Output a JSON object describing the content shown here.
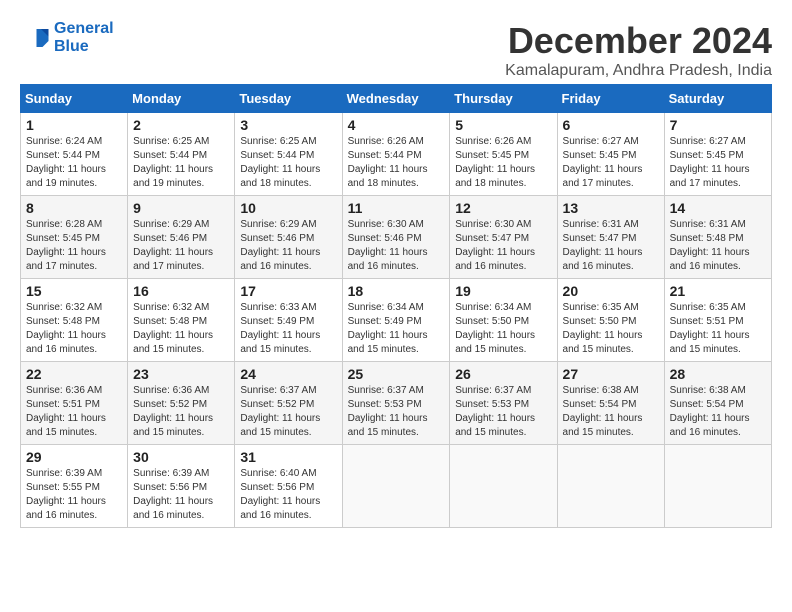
{
  "header": {
    "logo_line1": "General",
    "logo_line2": "Blue",
    "main_title": "December 2024",
    "subtitle": "Kamalapuram, Andhra Pradesh, India"
  },
  "weekdays": [
    "Sunday",
    "Monday",
    "Tuesday",
    "Wednesday",
    "Thursday",
    "Friday",
    "Saturday"
  ],
  "weeks": [
    [
      {
        "day": "1",
        "info": "Sunrise: 6:24 AM\nSunset: 5:44 PM\nDaylight: 11 hours\nand 19 minutes."
      },
      {
        "day": "2",
        "info": "Sunrise: 6:25 AM\nSunset: 5:44 PM\nDaylight: 11 hours\nand 19 minutes."
      },
      {
        "day": "3",
        "info": "Sunrise: 6:25 AM\nSunset: 5:44 PM\nDaylight: 11 hours\nand 18 minutes."
      },
      {
        "day": "4",
        "info": "Sunrise: 6:26 AM\nSunset: 5:44 PM\nDaylight: 11 hours\nand 18 minutes."
      },
      {
        "day": "5",
        "info": "Sunrise: 6:26 AM\nSunset: 5:45 PM\nDaylight: 11 hours\nand 18 minutes."
      },
      {
        "day": "6",
        "info": "Sunrise: 6:27 AM\nSunset: 5:45 PM\nDaylight: 11 hours\nand 17 minutes."
      },
      {
        "day": "7",
        "info": "Sunrise: 6:27 AM\nSunset: 5:45 PM\nDaylight: 11 hours\nand 17 minutes."
      }
    ],
    [
      {
        "day": "8",
        "info": "Sunrise: 6:28 AM\nSunset: 5:45 PM\nDaylight: 11 hours\nand 17 minutes."
      },
      {
        "day": "9",
        "info": "Sunrise: 6:29 AM\nSunset: 5:46 PM\nDaylight: 11 hours\nand 17 minutes."
      },
      {
        "day": "10",
        "info": "Sunrise: 6:29 AM\nSunset: 5:46 PM\nDaylight: 11 hours\nand 16 minutes."
      },
      {
        "day": "11",
        "info": "Sunrise: 6:30 AM\nSunset: 5:46 PM\nDaylight: 11 hours\nand 16 minutes."
      },
      {
        "day": "12",
        "info": "Sunrise: 6:30 AM\nSunset: 5:47 PM\nDaylight: 11 hours\nand 16 minutes."
      },
      {
        "day": "13",
        "info": "Sunrise: 6:31 AM\nSunset: 5:47 PM\nDaylight: 11 hours\nand 16 minutes."
      },
      {
        "day": "14",
        "info": "Sunrise: 6:31 AM\nSunset: 5:48 PM\nDaylight: 11 hours\nand 16 minutes."
      }
    ],
    [
      {
        "day": "15",
        "info": "Sunrise: 6:32 AM\nSunset: 5:48 PM\nDaylight: 11 hours\nand 16 minutes."
      },
      {
        "day": "16",
        "info": "Sunrise: 6:32 AM\nSunset: 5:48 PM\nDaylight: 11 hours\nand 15 minutes."
      },
      {
        "day": "17",
        "info": "Sunrise: 6:33 AM\nSunset: 5:49 PM\nDaylight: 11 hours\nand 15 minutes."
      },
      {
        "day": "18",
        "info": "Sunrise: 6:34 AM\nSunset: 5:49 PM\nDaylight: 11 hours\nand 15 minutes."
      },
      {
        "day": "19",
        "info": "Sunrise: 6:34 AM\nSunset: 5:50 PM\nDaylight: 11 hours\nand 15 minutes."
      },
      {
        "day": "20",
        "info": "Sunrise: 6:35 AM\nSunset: 5:50 PM\nDaylight: 11 hours\nand 15 minutes."
      },
      {
        "day": "21",
        "info": "Sunrise: 6:35 AM\nSunset: 5:51 PM\nDaylight: 11 hours\nand 15 minutes."
      }
    ],
    [
      {
        "day": "22",
        "info": "Sunrise: 6:36 AM\nSunset: 5:51 PM\nDaylight: 11 hours\nand 15 minutes."
      },
      {
        "day": "23",
        "info": "Sunrise: 6:36 AM\nSunset: 5:52 PM\nDaylight: 11 hours\nand 15 minutes."
      },
      {
        "day": "24",
        "info": "Sunrise: 6:37 AM\nSunset: 5:52 PM\nDaylight: 11 hours\nand 15 minutes."
      },
      {
        "day": "25",
        "info": "Sunrise: 6:37 AM\nSunset: 5:53 PM\nDaylight: 11 hours\nand 15 minutes."
      },
      {
        "day": "26",
        "info": "Sunrise: 6:37 AM\nSunset: 5:53 PM\nDaylight: 11 hours\nand 15 minutes."
      },
      {
        "day": "27",
        "info": "Sunrise: 6:38 AM\nSunset: 5:54 PM\nDaylight: 11 hours\nand 15 minutes."
      },
      {
        "day": "28",
        "info": "Sunrise: 6:38 AM\nSunset: 5:54 PM\nDaylight: 11 hours\nand 16 minutes."
      }
    ],
    [
      {
        "day": "29",
        "info": "Sunrise: 6:39 AM\nSunset: 5:55 PM\nDaylight: 11 hours\nand 16 minutes."
      },
      {
        "day": "30",
        "info": "Sunrise: 6:39 AM\nSunset: 5:56 PM\nDaylight: 11 hours\nand 16 minutes."
      },
      {
        "day": "31",
        "info": "Sunrise: 6:40 AM\nSunset: 5:56 PM\nDaylight: 11 hours\nand 16 minutes."
      },
      {
        "day": "",
        "info": ""
      },
      {
        "day": "",
        "info": ""
      },
      {
        "day": "",
        "info": ""
      },
      {
        "day": "",
        "info": ""
      }
    ]
  ]
}
